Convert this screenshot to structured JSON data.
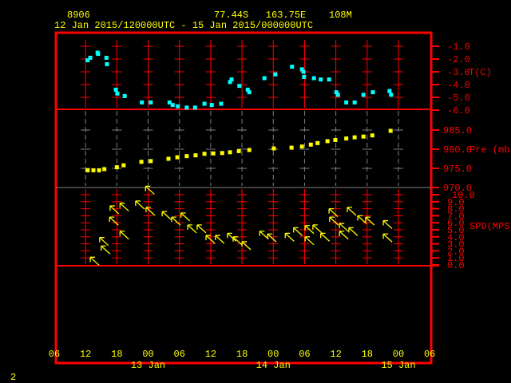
{
  "header": {
    "station": "8906",
    "location": "77.44S   163.75E    108M",
    "period": "12 Jan 2015/120000UTC - 15 Jan 2015/000000UTC"
  },
  "footer_label": "2",
  "colors": {
    "frame": "#ff0000",
    "temp": "#00ffff",
    "pressure": "#ffff00",
    "wind": "#ffff00",
    "grid_mid": "#808080"
  },
  "chart_data": [
    {
      "type": "scatter",
      "title": "Temperature",
      "ylabel": "T(C)",
      "ylim": [
        -6.0,
        -1.0
      ],
      "yticks": [
        "-1.0",
        "-2.0",
        "-3.0",
        "-4.0",
        "-5.0",
        "-6.0"
      ],
      "x_unit": "hours since 12 Jan 06UTC",
      "points": [
        [
          6.4,
          -2.1
        ],
        [
          6.9,
          -1.9
        ],
        [
          8.3,
          -1.5
        ],
        [
          8.4,
          -1.6
        ],
        [
          10.0,
          -1.9
        ],
        [
          10.1,
          -2.4
        ],
        [
          11.8,
          -4.4
        ],
        [
          12.1,
          -4.7
        ],
        [
          13.5,
          -4.9
        ],
        [
          16.8,
          -5.4
        ],
        [
          18.5,
          -5.4
        ],
        [
          22.1,
          -5.4
        ],
        [
          22.7,
          -5.6
        ],
        [
          23.7,
          -5.7
        ],
        [
          25.4,
          -5.8
        ],
        [
          27.0,
          -5.8
        ],
        [
          28.8,
          -5.5
        ],
        [
          30.2,
          -5.6
        ],
        [
          32.0,
          -5.5
        ],
        [
          33.7,
          -3.8
        ],
        [
          34.0,
          -3.6
        ],
        [
          35.5,
          -4.1
        ],
        [
          37.1,
          -4.4
        ],
        [
          37.4,
          -4.6
        ],
        [
          40.3,
          -3.5
        ],
        [
          42.4,
          -3.2
        ],
        [
          45.6,
          -2.6
        ],
        [
          47.5,
          -2.8
        ],
        [
          47.8,
          -3.0
        ],
        [
          47.9,
          -3.4
        ],
        [
          49.8,
          -3.5
        ],
        [
          51.1,
          -3.6
        ],
        [
          52.7,
          -3.6
        ],
        [
          54.1,
          -4.6
        ],
        [
          54.4,
          -4.8
        ],
        [
          56.0,
          -5.4
        ],
        [
          57.6,
          -5.4
        ],
        [
          59.3,
          -4.8
        ],
        [
          61.1,
          -4.6
        ],
        [
          64.3,
          -4.5
        ],
        [
          64.6,
          -4.8
        ]
      ]
    },
    {
      "type": "scatter",
      "title": "Pressure",
      "ylabel": "Pre (mb)",
      "ylim": [
        970.0,
        990.0
      ],
      "yticks": [
        "985.0",
        "980.0",
        "975.0",
        "970.0"
      ],
      "points": [
        [
          6.4,
          974.5
        ],
        [
          7.5,
          974.5
        ],
        [
          8.6,
          974.5
        ],
        [
          9.6,
          974.8
        ],
        [
          12.0,
          975.3
        ],
        [
          13.3,
          975.8
        ],
        [
          16.7,
          976.7
        ],
        [
          18.5,
          976.9
        ],
        [
          21.9,
          977.5
        ],
        [
          23.6,
          977.9
        ],
        [
          25.4,
          978.2
        ],
        [
          27.1,
          978.4
        ],
        [
          28.8,
          978.8
        ],
        [
          30.5,
          978.9
        ],
        [
          32.2,
          979.0
        ],
        [
          33.7,
          979.2
        ],
        [
          35.4,
          979.5
        ],
        [
          37.4,
          979.8
        ],
        [
          42.1,
          980.2
        ],
        [
          45.5,
          980.4
        ],
        [
          47.5,
          980.7
        ],
        [
          49.2,
          981.2
        ],
        [
          50.5,
          981.6
        ],
        [
          52.4,
          982.1
        ],
        [
          53.9,
          982.4
        ],
        [
          56.0,
          982.8
        ],
        [
          57.6,
          983.1
        ],
        [
          59.3,
          983.3
        ],
        [
          61.0,
          983.6
        ],
        [
          64.5,
          984.8
        ]
      ]
    },
    {
      "type": "scatter",
      "title": "Wind speed (arrows show direction)",
      "ylabel": "SPD(MPS)",
      "ylim": [
        0.0,
        10.0
      ],
      "yticks": [
        "10.0",
        "9.0",
        "8.0",
        "7.0",
        "6.0",
        "5.0",
        "4.0",
        "3.0",
        "2.0",
        "1.0",
        "0.0"
      ],
      "points": [
        [
          6.9,
          1.1
        ],
        [
          8.7,
          3.9
        ],
        [
          9.0,
          2.7
        ],
        [
          10.6,
          6.8
        ],
        [
          10.7,
          8.4
        ],
        [
          12.6,
          8.8
        ],
        [
          12.6,
          4.8
        ],
        [
          17.5,
          11.2
        ],
        [
          15.6,
          9.1
        ],
        [
          17.6,
          8.2
        ],
        [
          20.7,
          7.6
        ],
        [
          22.5,
          6.8
        ],
        [
          24.3,
          7.4
        ],
        [
          25.6,
          5.7
        ],
        [
          27.4,
          5.7
        ],
        [
          29.1,
          4.2
        ],
        [
          30.9,
          4.2
        ],
        [
          33.2,
          4.5
        ],
        [
          34.3,
          4.0
        ],
        [
          36.0,
          3.3
        ],
        [
          39.4,
          4.8
        ],
        [
          40.9,
          4.4
        ],
        [
          44.3,
          4.5
        ],
        [
          45.9,
          5.3
        ],
        [
          48.1,
          5.6
        ],
        [
          49.6,
          5.7
        ],
        [
          51.1,
          4.5
        ],
        [
          48.1,
          4.0
        ],
        [
          52.7,
          8.0
        ],
        [
          52.8,
          6.8
        ],
        [
          54.7,
          5.9
        ],
        [
          54.7,
          4.8
        ],
        [
          56.5,
          5.3
        ],
        [
          56.2,
          8.2
        ],
        [
          58.2,
          7.0
        ],
        [
          59.7,
          6.8
        ],
        [
          63.1,
          6.3
        ],
        [
          63.1,
          4.4
        ]
      ]
    }
  ],
  "x_axis": {
    "range_hours": [
      0,
      72
    ],
    "tick_labels": [
      "06",
      "12",
      "18",
      "00",
      "06",
      "12",
      "18",
      "00",
      "06",
      "12",
      "18",
      "00",
      "06"
    ],
    "day_labels": [
      {
        "text": "13 Jan",
        "hour": 18
      },
      {
        "text": "14 Jan",
        "hour": 42
      },
      {
        "text": "15 Jan",
        "hour": 66
      }
    ]
  }
}
